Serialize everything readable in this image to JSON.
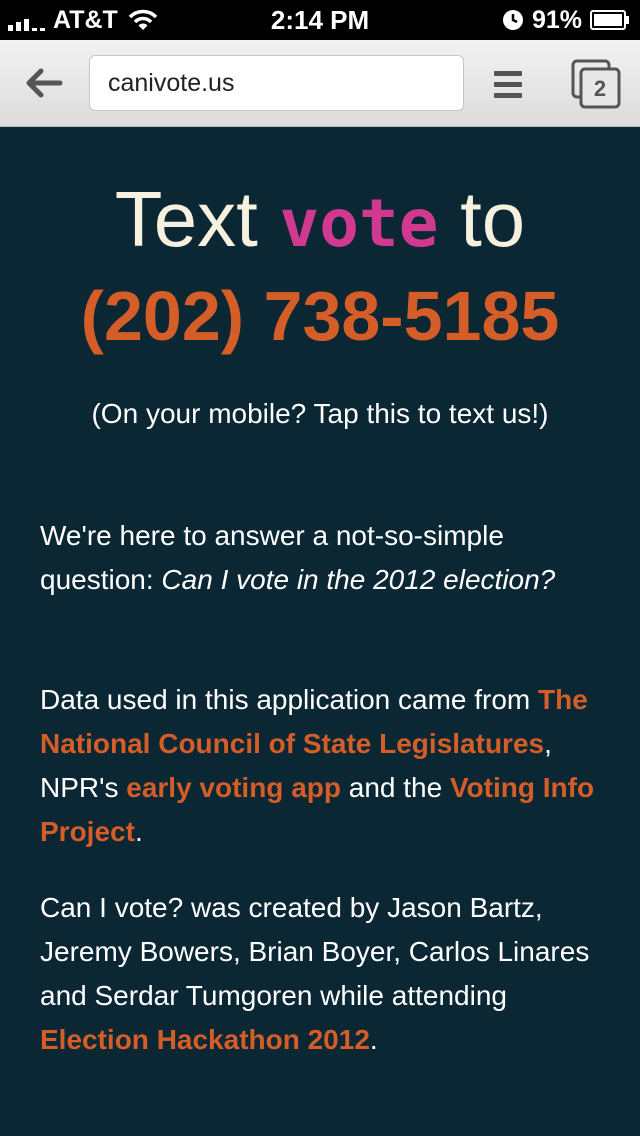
{
  "status_bar": {
    "carrier": "AT&T",
    "time": "2:14 PM",
    "battery": "91%"
  },
  "browser": {
    "url": "canivote.us",
    "tab_count": "2"
  },
  "hero": {
    "text_word": "Text",
    "keyword": "vote",
    "to_word": "to",
    "phone": "(202) 738-5185",
    "tap_hint": "(On your mobile? Tap this to text us!)"
  },
  "intro": {
    "lead": "We're here to answer a not-so-simple question: ",
    "question": "Can I vote in the 2012 election?"
  },
  "data_para": {
    "prefix": "Data used in this application came from ",
    "link1": "The National Council of State Legislatures",
    "mid1": ", NPR's ",
    "link2": "early voting app",
    "mid2": " and the ",
    "link3": "Voting Info Project",
    "suffix": "."
  },
  "credits": {
    "text": "Can I vote? was created by Jason Bartz, Jeremy Bowers, Brian Boyer, Carlos Linares and Serdar Tumgoren while attending ",
    "link": "Election Hackathon 2012",
    "suffix": "."
  },
  "colors": {
    "background": "#0a2733",
    "accent_orange": "#d55d27",
    "accent_pink": "#d1388f",
    "cream": "#f6f1df"
  },
  "icons": [
    "signal-icon",
    "wifi-icon",
    "clock-icon",
    "battery-icon",
    "back-arrow-icon",
    "menu-icon",
    "tabs-icon"
  ]
}
